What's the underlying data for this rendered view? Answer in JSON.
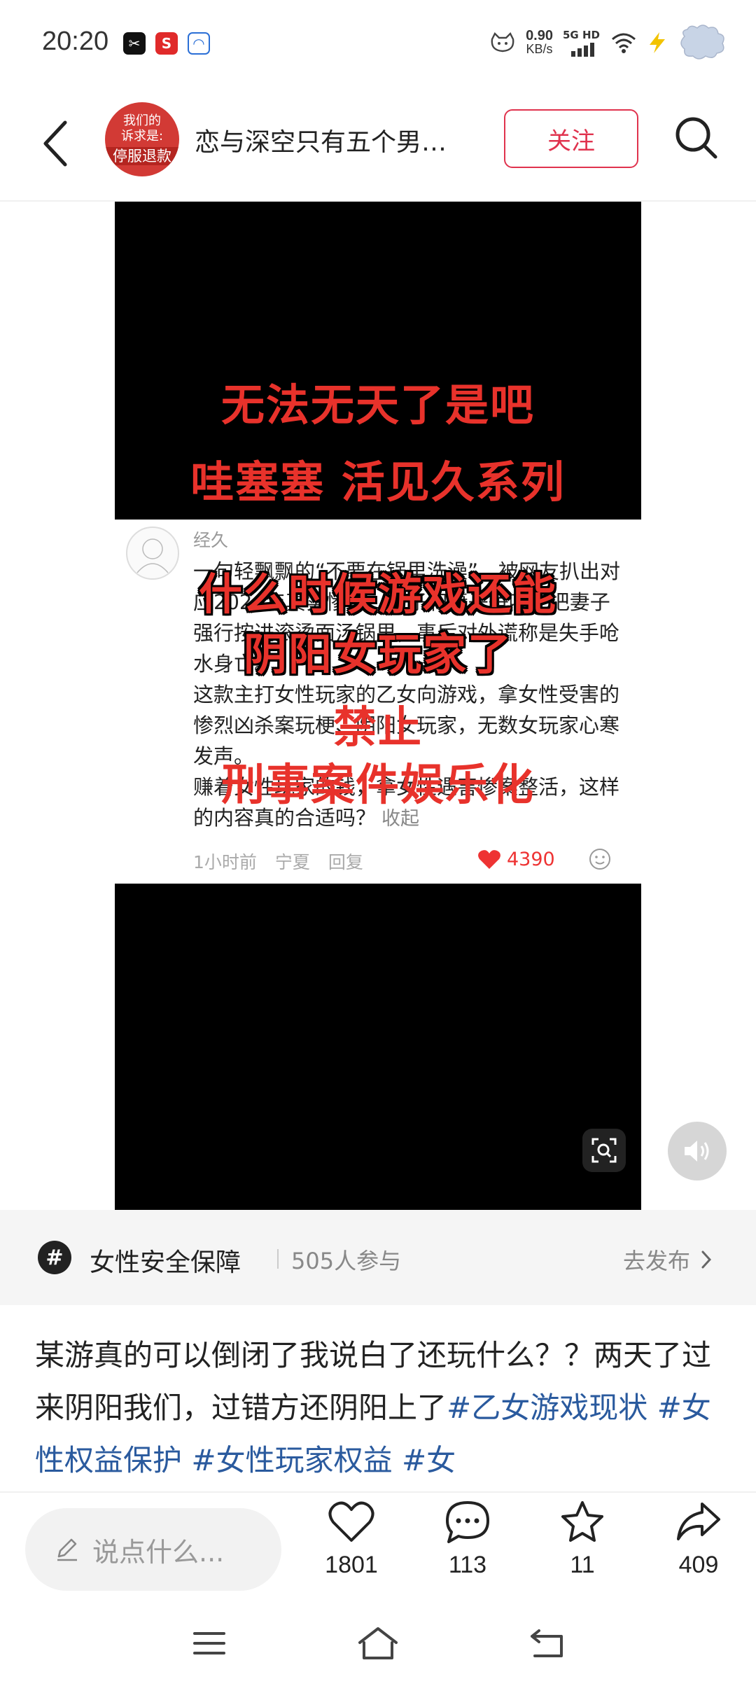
{
  "status_bar": {
    "time": "20:20",
    "net_speed_value": "0.90",
    "net_speed_unit": "KB/s",
    "network_label": "5G HD"
  },
  "header": {
    "avatar_text_top": "我们的",
    "avatar_text_mid": "诉求是:",
    "avatar_text_bottom": "停服退款",
    "account_name": "恋与深空只有五个男…",
    "follow_label": "关注"
  },
  "media": {
    "top_line_1": "无法无天了是吧",
    "top_line_2": "哇塞塞 活见久系列",
    "comment": {
      "user": "经久",
      "paragraphs": [
        "一句轻飘飘的“不要在锅里洗澡”，被网友扒出对应2024年真实惨案：男子和妻子争吵，把妻子强行按进滚烫面汤锅里，事后对外谎称是失手呛水身亡。",
        "这款主打女性玩家的乙女向游戏，拿女性受害的惨烈凶杀案玩梗、阴阳女玩家，无数女玩家心寒发声。",
        "赚着女性玩家的钱，拿女性遇害惨案整活，这样的内容真的合适吗？"
      ],
      "collapse": "收起",
      "time": "1小时前",
      "location": "宁夏",
      "reply": "回复",
      "likes": "4390"
    },
    "bottom_line_1": "什么时候游戏还能",
    "bottom_line_2": "阴阳女玩家了",
    "bottom_line_3": "禁止",
    "bottom_line_4": "刑事案件娱乐化"
  },
  "topic": {
    "icon": "#",
    "name": "女性安全保障",
    "participants": "505人参与",
    "publish": "去发布"
  },
  "caption": {
    "text": "某游真的可以倒闭了我说白了还玩什么？？两天了过来阴阳我们，过错方还阴阳上了",
    "hashtags": [
      "#乙女游戏现状",
      "#女性权益保护",
      "#女性玩家权益",
      "#女"
    ]
  },
  "actions": {
    "input_placeholder": "说点什么...",
    "likes": "1801",
    "comments": "113",
    "favorites": "11",
    "shares": "409"
  },
  "colors": {
    "accent": "#e0334e",
    "overlay_red": "#e8322b",
    "hashtag": "#2a5a9e"
  }
}
